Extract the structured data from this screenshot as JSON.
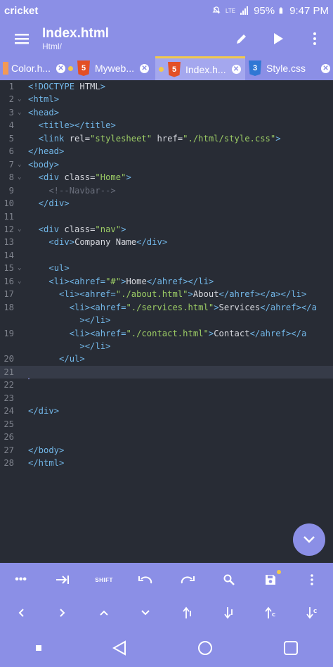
{
  "status_bar": {
    "carrier": "cricket",
    "network": "LTE",
    "battery": "95%",
    "time": "9:47 PM"
  },
  "app_bar": {
    "title": "Index.html",
    "subtitle": "Html/"
  },
  "tabs": [
    {
      "label": "Color.h...",
      "icon": "file-icon",
      "modified": false
    },
    {
      "label": "Myweb...",
      "icon": "html5-icon",
      "modified": true
    },
    {
      "label": "Index.h...",
      "icon": "html5-icon",
      "modified": true,
      "active": true
    },
    {
      "label": "Style.css",
      "icon": "css3-icon",
      "modified": false
    }
  ],
  "editor": {
    "current_line": 21,
    "lines": [
      {
        "n": "1",
        "code": "<!DOCTYPE HTML>"
      },
      {
        "n": "2",
        "code": "<html>"
      },
      {
        "n": "3",
        "code": "<head>"
      },
      {
        "n": "4",
        "code": "  <title></title>"
      },
      {
        "n": "5",
        "code": "  <link rel=\"stylesheet\" href=\"./html/style.css\">"
      },
      {
        "n": "6",
        "code": "</head>"
      },
      {
        "n": "7",
        "code": "<body>"
      },
      {
        "n": "8",
        "code": "  <div class=\"Home\">"
      },
      {
        "n": "9",
        "code": "    <!--Navbar-->"
      },
      {
        "n": "10",
        "code": "  </div>"
      },
      {
        "n": "11",
        "code": ""
      },
      {
        "n": "12",
        "code": "  <div class=\"nav\">"
      },
      {
        "n": "13",
        "code": "    <div>Company Name</div>"
      },
      {
        "n": "14",
        "code": ""
      },
      {
        "n": "15",
        "code": "    <ul>"
      },
      {
        "n": "16",
        "code": "    <li><ahref=\"#\">Home</ahref></li>"
      },
      {
        "n": "17",
        "code": "      <li><ahref=\"./about.html\">About</ahref></a></li>"
      },
      {
        "n": "18",
        "code": "        <li><ahref=\"./services.html\">Services</ahref></a"
      },
      {
        "n": "",
        "code": "          ></li>"
      },
      {
        "n": "19",
        "code": "        <li><ahref=\"./contact.html\">Contact</ahref></a"
      },
      {
        "n": "",
        "code": "          ></li>"
      },
      {
        "n": "20",
        "code": "      </ul>"
      },
      {
        "n": "21",
        "code": ""
      },
      {
        "n": "22",
        "code": ""
      },
      {
        "n": "23",
        "code": ""
      },
      {
        "n": "24",
        "code": "</div>"
      },
      {
        "n": "25",
        "code": ""
      },
      {
        "n": "26",
        "code": ""
      },
      {
        "n": "27",
        "code": "</body>"
      },
      {
        "n": "28",
        "code": "</html>"
      }
    ]
  },
  "toolbar_row1": [
    {
      "name": "more-symbols-button",
      "icon": "ellipsis-icon"
    },
    {
      "name": "tab-indent-button",
      "icon": "tab-icon"
    },
    {
      "name": "shift-button",
      "label": "SHIFT"
    },
    {
      "name": "undo-button",
      "icon": "undo-icon"
    },
    {
      "name": "redo-button",
      "icon": "redo-icon"
    },
    {
      "name": "search-button",
      "icon": "search-icon"
    },
    {
      "name": "save-button",
      "icon": "save-icon"
    },
    {
      "name": "overflow-button",
      "icon": "more-vert-icon"
    }
  ],
  "toolbar_row2": [
    {
      "name": "cursor-left-button",
      "icon": "chevron-left-icon"
    },
    {
      "name": "cursor-right-button",
      "icon": "chevron-right-icon"
    },
    {
      "name": "cursor-up-button",
      "icon": "chevron-up-icon"
    },
    {
      "name": "cursor-down-button",
      "icon": "chevron-down-icon"
    },
    {
      "name": "move-line-start-button",
      "icon": "arrow-up-bar-icon"
    },
    {
      "name": "move-line-end-button",
      "icon": "arrow-down-bar-icon"
    },
    {
      "name": "doc-start-button",
      "icon": "arrow-up-c-icon"
    },
    {
      "name": "doc-end-button",
      "icon": "arrow-down-c-icon"
    }
  ],
  "colors": {
    "accent": "#8b8fe6",
    "editor_bg": "#282c35",
    "tag": "#72b7e8",
    "string": "#9ccc65",
    "modified_dot": "#f2c94c"
  }
}
